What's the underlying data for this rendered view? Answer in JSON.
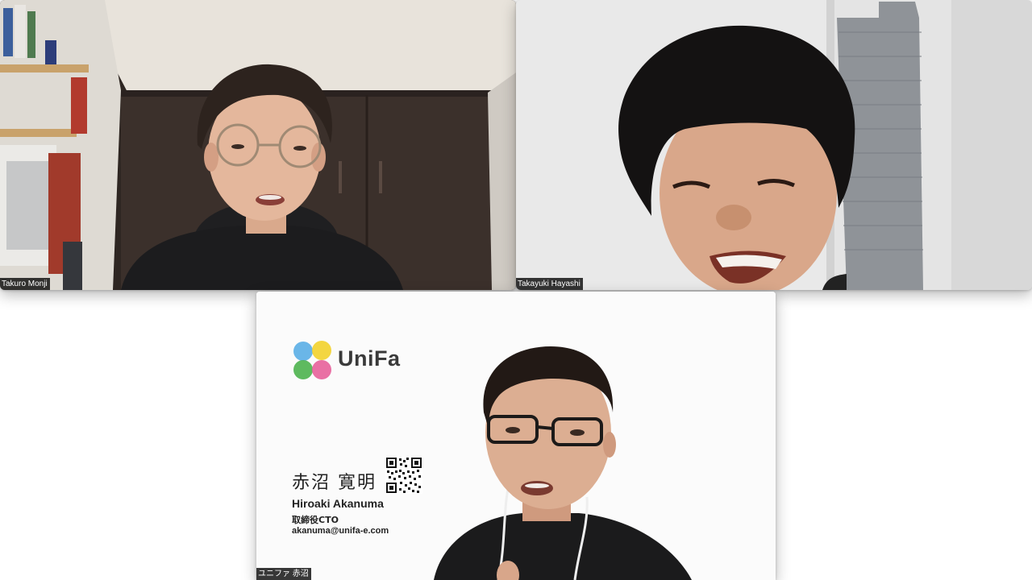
{
  "participants": [
    {
      "display_name": "Takuro Monji"
    },
    {
      "display_name": "Takayuki Hayashi"
    },
    {
      "display_name": "ユニファ 赤沼"
    }
  ],
  "virtual_background": {
    "brand": "UniFa",
    "name_jp": "赤沼 寛明",
    "name_en": "Hiroaki Akanuma",
    "role": "取締役CTO",
    "email": "akanuma@unifa-e.com",
    "logo_colors": [
      "#5aaee6",
      "#f2d12c",
      "#4db24e",
      "#e7609a"
    ]
  }
}
